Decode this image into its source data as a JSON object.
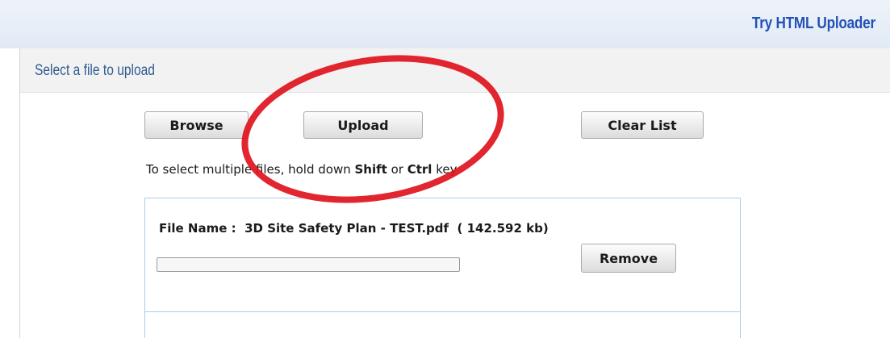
{
  "header": {
    "try_link": "Try HTML Uploader"
  },
  "panel": {
    "title": "Select a file to upload"
  },
  "toolbar": {
    "browse_label": "Browse",
    "upload_label": "Upload",
    "clear_label": "Clear List"
  },
  "hint": {
    "prefix": "To select multiple files, hold down ",
    "key1": "Shift",
    "middle": " or ",
    "key2": "Ctrl",
    "suffix": " key"
  },
  "file": {
    "label": "File Name :",
    "name": "3D Site Safety Plan - TEST.pdf",
    "size": "( 142.592 kb)",
    "progress": 0,
    "remove_label": "Remove"
  },
  "colors": {
    "link": "#2451b8",
    "panel_title": "#2e5c92",
    "annotation": "#e0141e",
    "box_border": "#a9cde6"
  }
}
